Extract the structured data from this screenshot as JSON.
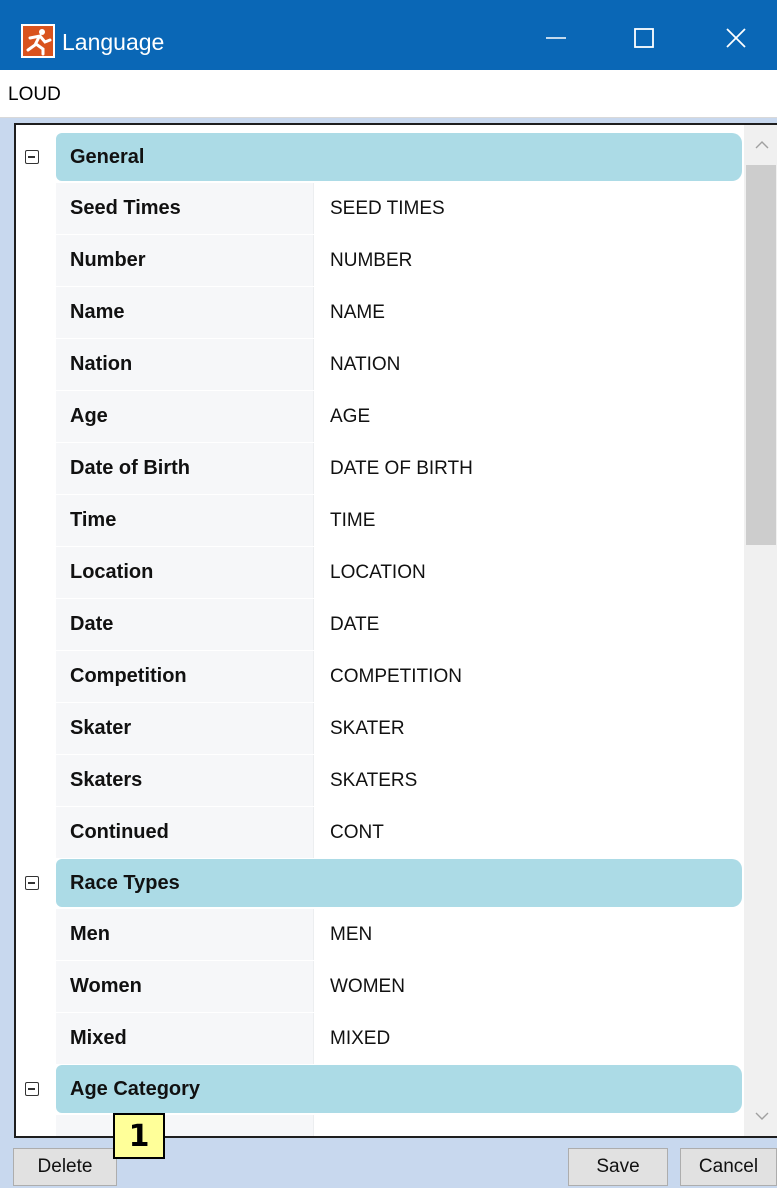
{
  "window": {
    "title": "Language",
    "icon": "skater-app-icon",
    "controls": [
      "minimize-icon",
      "maximize-icon",
      "close-icon"
    ]
  },
  "language_name": {
    "value": "LOUD"
  },
  "categories": [
    {
      "label": "General",
      "expanded": true,
      "rows": [
        {
          "name": "Seed Times",
          "value": "SEED TIMES"
        },
        {
          "name": "Number",
          "value": "NUMBER"
        },
        {
          "name": "Name",
          "value": "NAME"
        },
        {
          "name": "Nation",
          "value": "NATION"
        },
        {
          "name": "Age",
          "value": "AGE"
        },
        {
          "name": "Date of Birth",
          "value": "DATE OF BIRTH"
        },
        {
          "name": "Time",
          "value": "TIME"
        },
        {
          "name": "Location",
          "value": "LOCATION"
        },
        {
          "name": "Date",
          "value": "DATE"
        },
        {
          "name": "Competition",
          "value": "COMPETITION"
        },
        {
          "name": "Skater",
          "value": "SKATER"
        },
        {
          "name": "Skaters",
          "value": "SKATERS"
        },
        {
          "name": "Continued",
          "value": "CONT"
        }
      ]
    },
    {
      "label": "Race Types",
      "expanded": true,
      "rows": [
        {
          "name": "Men",
          "value": "MEN"
        },
        {
          "name": "Women",
          "value": "WOMEN"
        },
        {
          "name": "Mixed",
          "value": "MIXED"
        }
      ]
    },
    {
      "label": "Age Category",
      "expanded": true,
      "rows": [
        {
          "name": "",
          "value": ""
        }
      ]
    }
  ],
  "buttons": {
    "delete": "Delete",
    "save": "Save",
    "cancel": "Cancel"
  },
  "annotation_badge": "1",
  "colors": {
    "titlebar": "#0a67b6",
    "category_header": "#acdbe6",
    "window_background": "#c8d8ee",
    "badge": "#ffff99"
  }
}
